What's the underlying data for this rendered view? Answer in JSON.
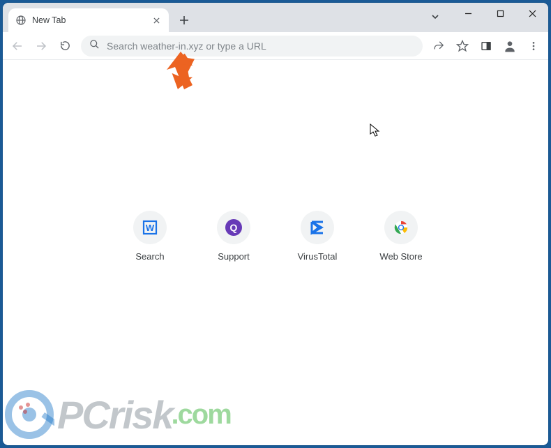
{
  "tab": {
    "title": "New Tab"
  },
  "omnibox": {
    "placeholder": "Search weather-in.xyz or type a URL"
  },
  "shortcuts": [
    {
      "label": "Search",
      "icon": "search-tile"
    },
    {
      "label": "Support",
      "icon": "support-tile"
    },
    {
      "label": "VirusTotal",
      "icon": "virustotal-tile"
    },
    {
      "label": "Web Store",
      "icon": "webstore-tile"
    }
  ],
  "watermark": {
    "brand": "PCrisk",
    "tld": ".com"
  },
  "colors": {
    "accent_orange": "#ec6321",
    "tile_blue": "#1a73e8",
    "tile_purple": "#673ab7"
  }
}
